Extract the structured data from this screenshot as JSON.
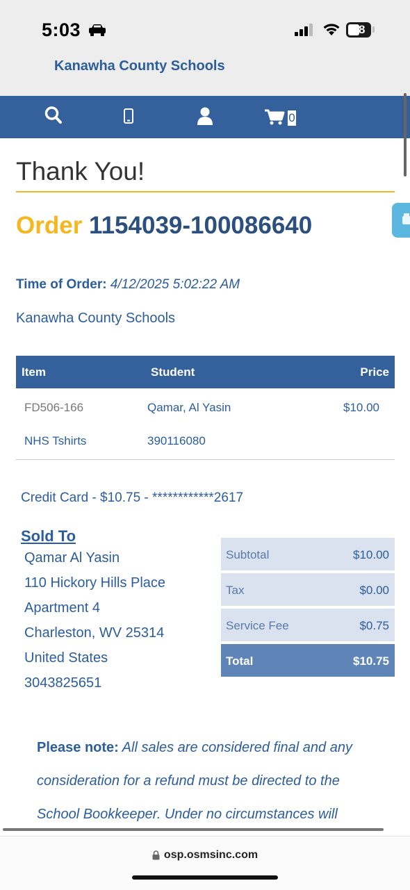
{
  "status_bar": {
    "time": "5:03",
    "battery": "48"
  },
  "header": {
    "site_title": "Kanawha County Schools"
  },
  "nav": {
    "icons": [
      "search-icon",
      "mobile-icon",
      "user-icon",
      "cart-icon"
    ],
    "cart_count": "0"
  },
  "page": {
    "heading": "Thank You!",
    "order_word": "Order",
    "order_number": "1154039-100086640",
    "time_label": "Time of Order:",
    "time_value": "4/12/2025 5:02:22 AM",
    "district": "Kanawha County Schools"
  },
  "items_table": {
    "headers": [
      "Item",
      "Student",
      "Price"
    ],
    "rows": [
      {
        "item_code": "FD506-166",
        "student_name": "Qamar, Al Yasin",
        "price": "$10.00",
        "item_name": "NHS Tshirts",
        "student_id": "390116080"
      }
    ]
  },
  "payment": {
    "text": "Credit Card - $10.75 - ************2617"
  },
  "sold_to": {
    "label": "Sold To",
    "name": "Qamar Al Yasin",
    "address1": "110 Hickory Hills Place",
    "address2": "Apartment 4",
    "city_state_zip": "Charleston, WV 25314",
    "country": "United States",
    "phone": "3043825651"
  },
  "totals": {
    "subtotal_label": "Subtotal",
    "subtotal": "$10.00",
    "tax_label": "Tax",
    "tax": "$0.00",
    "fee_label": "Service Fee",
    "fee": "$0.75",
    "total_label": "Total",
    "total": "$10.75"
  },
  "note": {
    "label": "Please note:",
    "text": "All sales are considered final and any consideration for a refund must be directed to the School Bookkeeper. Under no circumstances will"
  },
  "browser": {
    "url": "osp.osmsinc.com"
  },
  "colors": {
    "navy": "#34609c",
    "accent": "#f5b71f",
    "text_blue": "#2b5d9c"
  }
}
